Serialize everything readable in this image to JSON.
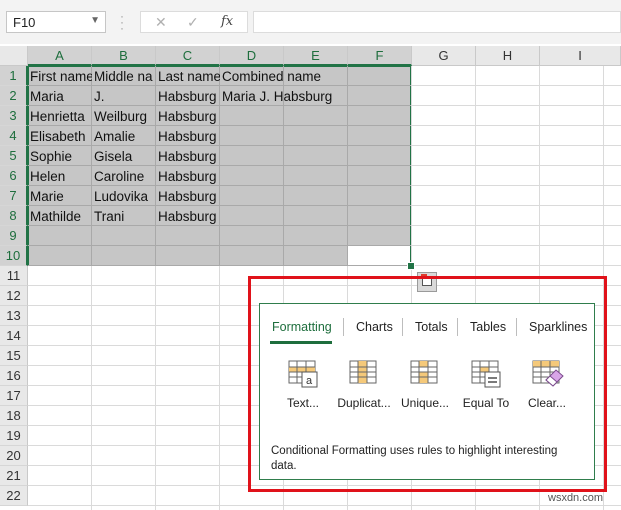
{
  "formula_bar": {
    "name_box": "F10",
    "fx_label": "fx",
    "cancel_glyph": "✕",
    "enter_glyph": "✓",
    "formula": ""
  },
  "columns": [
    "A",
    "B",
    "C",
    "D",
    "E",
    "F",
    "G",
    "H",
    "I"
  ],
  "rows": [
    "1",
    "2",
    "3",
    "4",
    "5",
    "6",
    "7",
    "8",
    "9",
    "10",
    "11",
    "12",
    "13",
    "14",
    "15",
    "16",
    "17",
    "18",
    "19",
    "20",
    "21",
    "22"
  ],
  "cells": {
    "a1": "First name",
    "b1": "Middle na",
    "c1": "Last name",
    "d1": "Combined name",
    "a2": "Maria",
    "b2": "J.",
    "c2": "Habsburg",
    "d2": "Maria  J. Habsburg",
    "a3": "Henrietta",
    "b3": "Weilburg",
    "c3": "Habsburg",
    "a4": "Elisabeth",
    "b4": "Amalie",
    "c4": "Habsburg",
    "a5": "Sophie",
    "b5": "Gisela",
    "c5": "Habsburg",
    "a6": "Helen",
    "b6": "Caroline",
    "c6": "Habsburg",
    "a7": "Marie",
    "b7": "Ludovika",
    "c7": "Habsburg",
    "a8": "Mathilde",
    "b8": "Trani",
    "c8": "Habsburg"
  },
  "quick_analysis": {
    "tabs": [
      {
        "label": "Formatting",
        "active": true
      },
      {
        "label": "Charts",
        "active": false
      },
      {
        "label": "Totals",
        "active": false
      },
      {
        "label": "Tables",
        "active": false
      },
      {
        "label": "Sparklines",
        "active": false
      }
    ],
    "options": [
      {
        "label": "Text...",
        "icon": "text-contains-icon"
      },
      {
        "label": "Duplicat...",
        "icon": "duplicate-values-icon"
      },
      {
        "label": "Unique...",
        "icon": "unique-values-icon"
      },
      {
        "label": "Equal To",
        "icon": "equal-to-icon"
      },
      {
        "label": "Clear...",
        "icon": "clear-format-icon"
      }
    ],
    "description": "Conditional Formatting uses rules to highlight interesting data."
  },
  "colors": {
    "accent": "#217346",
    "highlight_box": "#e0121a",
    "selection_fill": "#c6c6c6"
  },
  "watermark": "wsxdn.com"
}
